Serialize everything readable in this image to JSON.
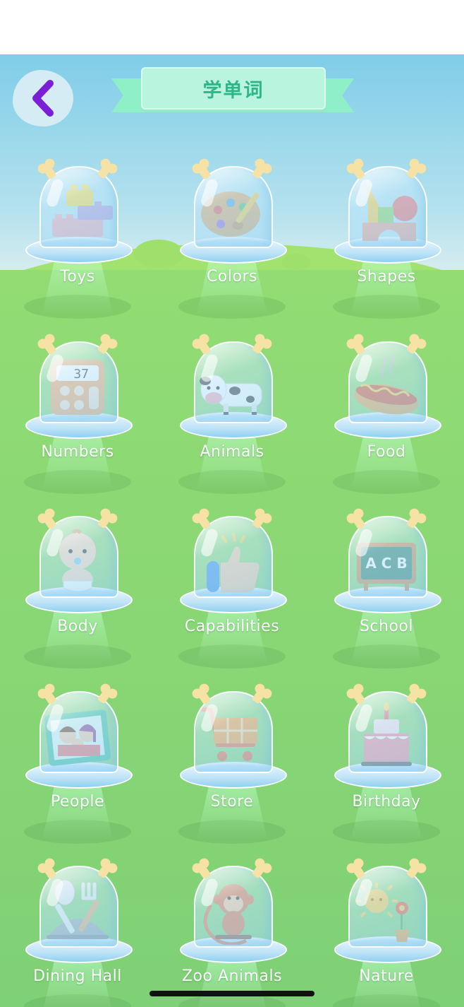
{
  "header": {
    "title": "学单词",
    "back_icon": "chevron-left-icon"
  },
  "colors": {
    "accent_purple": "#7a1fd6",
    "title_green": "#2fb58a",
    "ribbon": "#b8f4de"
  },
  "categories": [
    {
      "label": "Toys",
      "icon": "toy-blocks-icon"
    },
    {
      "label": "Colors",
      "icon": "paint-palette-icon"
    },
    {
      "label": "Shapes",
      "icon": "shapes-icon"
    },
    {
      "label": "Numbers",
      "icon": "calculator-icon",
      "display": "37"
    },
    {
      "label": "Animals",
      "icon": "cow-icon"
    },
    {
      "label": "Food",
      "icon": "hotdog-icon"
    },
    {
      "label": "Body",
      "icon": "baby-icon"
    },
    {
      "label": "Capabilities",
      "icon": "thumbs-up-icon"
    },
    {
      "label": "School",
      "icon": "chalkboard-icon",
      "board_text": "ACB"
    },
    {
      "label": "People",
      "icon": "family-photo-icon"
    },
    {
      "label": "Store",
      "icon": "shopping-cart-icon"
    },
    {
      "label": "Birthday",
      "icon": "birthday-cake-icon"
    },
    {
      "label": "Dining Hall",
      "icon": "spoon-fork-icon"
    },
    {
      "label": "Zoo Animals",
      "icon": "monkey-icon"
    },
    {
      "label": "Nature",
      "icon": "sun-flower-icon"
    }
  ]
}
